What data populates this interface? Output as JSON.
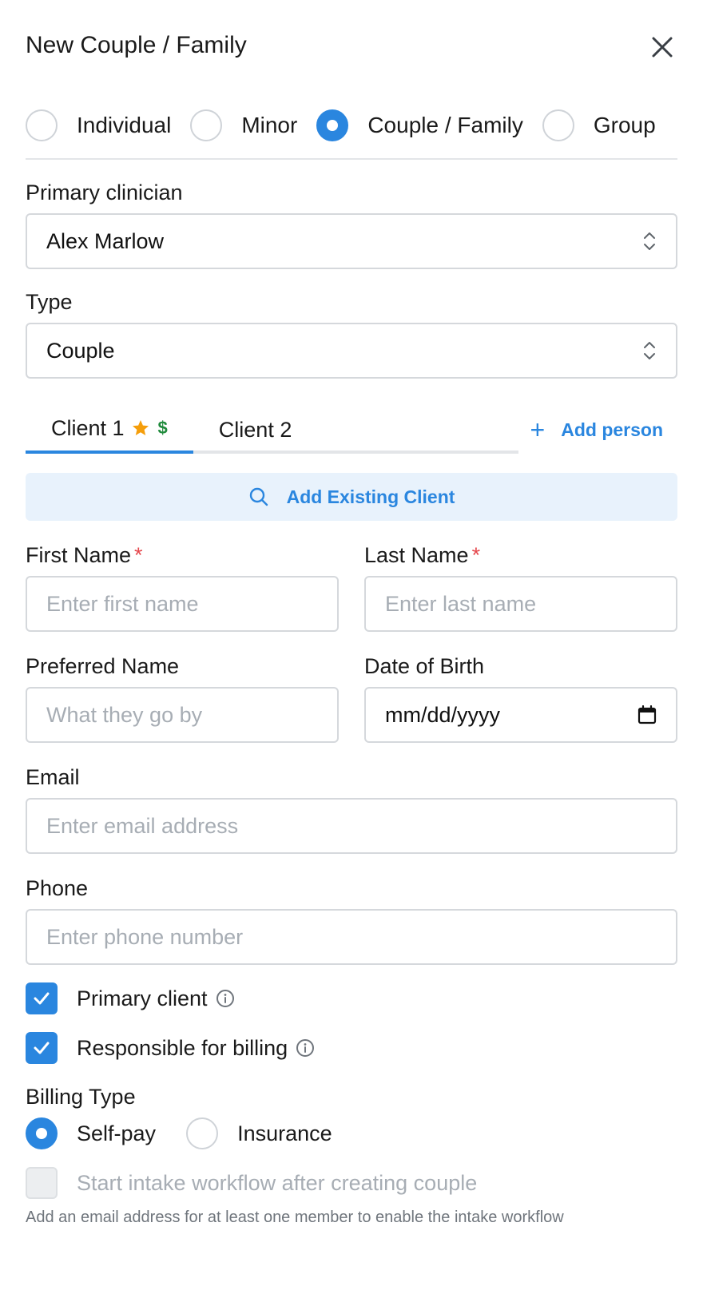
{
  "header": {
    "title": "New Couple / Family"
  },
  "kinds": [
    {
      "label": "Individual",
      "selected": false
    },
    {
      "label": "Minor",
      "selected": false
    },
    {
      "label": "Couple / Family",
      "selected": true
    },
    {
      "label": "Group",
      "selected": false
    }
  ],
  "primary_clinician": {
    "label": "Primary clinician",
    "value": "Alex Marlow"
  },
  "type": {
    "label": "Type",
    "value": "Couple"
  },
  "tabs": [
    {
      "label": "Client 1",
      "active": true
    },
    {
      "label": "Client 2",
      "active": false
    }
  ],
  "tab_badges": {
    "dollar": "$"
  },
  "add_person": {
    "label": "Add person"
  },
  "add_existing": {
    "label": "Add Existing Client"
  },
  "form": {
    "first_name": {
      "label": "First Name",
      "required_mark": "*",
      "placeholder": "Enter first name"
    },
    "last_name": {
      "label": "Last Name",
      "required_mark": "*",
      "placeholder": "Enter last name"
    },
    "preferred_name": {
      "label": "Preferred Name",
      "placeholder": "What they go by"
    },
    "dob": {
      "label": "Date of Birth",
      "value": "mm/dd/yyyy"
    },
    "email": {
      "label": "Email",
      "placeholder": "Enter email address"
    },
    "phone": {
      "label": "Phone",
      "placeholder": "Enter phone number"
    }
  },
  "checks": {
    "primary_client": {
      "label": "Primary client",
      "checked": true
    },
    "responsible_billing": {
      "label": "Responsible for billing",
      "checked": true
    }
  },
  "billing": {
    "label": "Billing Type",
    "options": [
      {
        "label": "Self-pay",
        "selected": true
      },
      {
        "label": "Insurance",
        "selected": false
      }
    ]
  },
  "intake": {
    "label": "Start intake workflow after creating couple",
    "help": "Add an email address for at least one member to enable the intake workflow",
    "checked": false,
    "disabled": true
  },
  "colors": {
    "accent": "#2a86df",
    "star": "#f59e0b",
    "dollar": "#1f8a3b",
    "required": "#e5484d"
  },
  "icons": [
    "close-icon",
    "chevron-updown-icon",
    "star-icon",
    "plus-icon",
    "search-icon",
    "check-icon",
    "info-icon",
    "calendar-icon"
  ]
}
